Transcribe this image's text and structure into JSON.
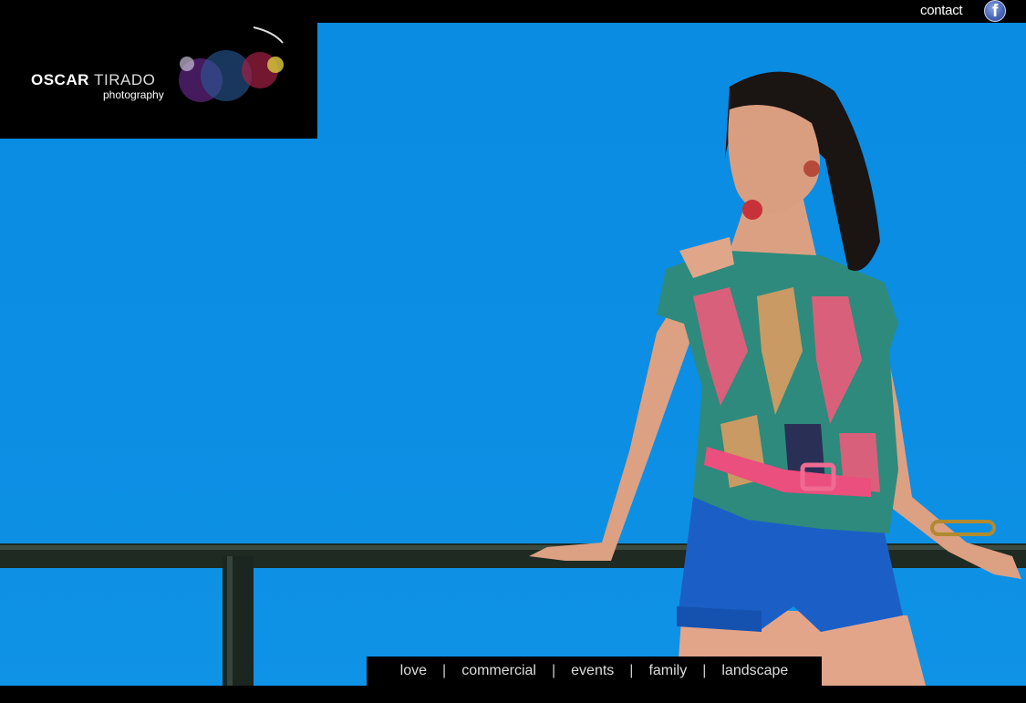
{
  "header": {
    "contact_label": "contact",
    "facebook_icon": "facebook-icon"
  },
  "logo": {
    "name_part1": "OSCAR",
    "name_part2": "TIRADO",
    "tagline": "photography"
  },
  "nav": {
    "items": [
      "love",
      "commercial",
      "events",
      "family",
      "landscape"
    ],
    "separator": "|"
  },
  "colors": {
    "sky": "#0b8ee3",
    "background": "#000000",
    "facebook": "#3b5998"
  }
}
